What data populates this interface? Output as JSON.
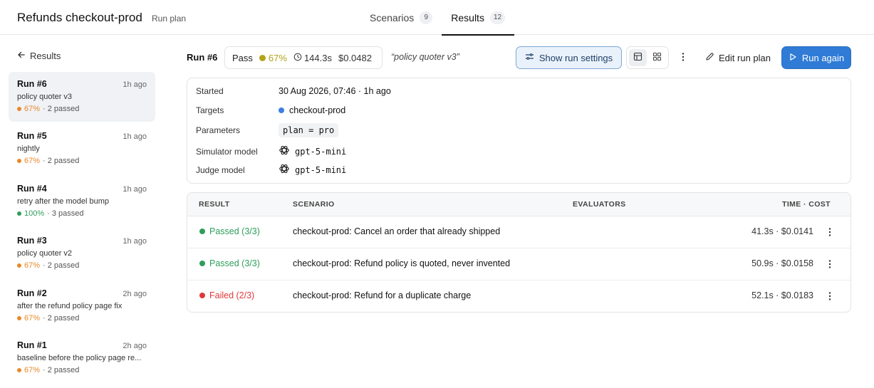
{
  "header": {
    "title": "Refunds checkout-prod",
    "subtitle": "Run plan",
    "tabs": [
      {
        "label": "Scenarios",
        "count": "9"
      },
      {
        "label": "Results",
        "count": "12"
      }
    ]
  },
  "sidebar": {
    "back_label": "Results",
    "runs": [
      {
        "name": "Run #6",
        "ago": "1h ago",
        "desc": "policy quoter v3",
        "pct": "67%",
        "passed": "· 2 passed",
        "color": "#e8892b"
      },
      {
        "name": "Run #5",
        "ago": "1h ago",
        "desc": "nightly",
        "pct": "67%",
        "passed": "· 2 passed",
        "color": "#e8892b"
      },
      {
        "name": "Run #4",
        "ago": "1h ago",
        "desc": "retry after the model bump",
        "pct": "100%",
        "passed": "· 3 passed",
        "color": "#2e9e5b"
      },
      {
        "name": "Run #3",
        "ago": "1h ago",
        "desc": "policy quoter v2",
        "pct": "67%",
        "passed": "· 2 passed",
        "color": "#e8892b"
      },
      {
        "name": "Run #2",
        "ago": "2h ago",
        "desc": "after the refund policy page fix",
        "pct": "67%",
        "passed": "· 2 passed",
        "color": "#e8892b"
      },
      {
        "name": "Run #1",
        "ago": "2h ago",
        "desc": "baseline before the policy page re...",
        "pct": "67%",
        "passed": "· 2 passed",
        "color": "#e8892b"
      }
    ]
  },
  "run": {
    "label": "Run #6",
    "status": "Pass",
    "pct": "67%",
    "time": "144.3s",
    "cost": "$0.0482",
    "note": "“policy quoter v3”"
  },
  "actions": {
    "settings_label": "Show run settings",
    "edit_label": "Edit run plan",
    "run_again_label": "Run again"
  },
  "details": {
    "started_label": "Started",
    "started_value": "30 Aug 2026, 07:46 · 1h ago",
    "targets_label": "Targets",
    "targets_value": "checkout-prod",
    "target_color": "#3b7fe0",
    "params_label": "Parameters",
    "params_value": "plan = pro",
    "sim_label": "Simulator model",
    "sim_value": "gpt-5-mini",
    "judge_label": "Judge model",
    "judge_value": "gpt-5-mini"
  },
  "results": {
    "headers": {
      "result": "RESULT",
      "scenario": "SCENARIO",
      "evaluators": "EVALUATORS",
      "time_cost": "TIME · COST"
    },
    "rows": [
      {
        "result": "Passed (3/3)",
        "status_color": "#2e9e5b",
        "scenario": "checkout-prod: Cancel an order that already shipped",
        "time_cost": "41.3s · $0.0141"
      },
      {
        "result": "Passed (3/3)",
        "status_color": "#2e9e5b",
        "scenario": "checkout-prod: Refund policy is quoted, never invented",
        "time_cost": "50.9s · $0.0158"
      },
      {
        "result": "Failed (2/3)",
        "status_color": "#e0383b",
        "scenario": "checkout-prod: Refund for a duplicate charge",
        "time_cost": "52.1s · $0.0183"
      }
    ]
  }
}
